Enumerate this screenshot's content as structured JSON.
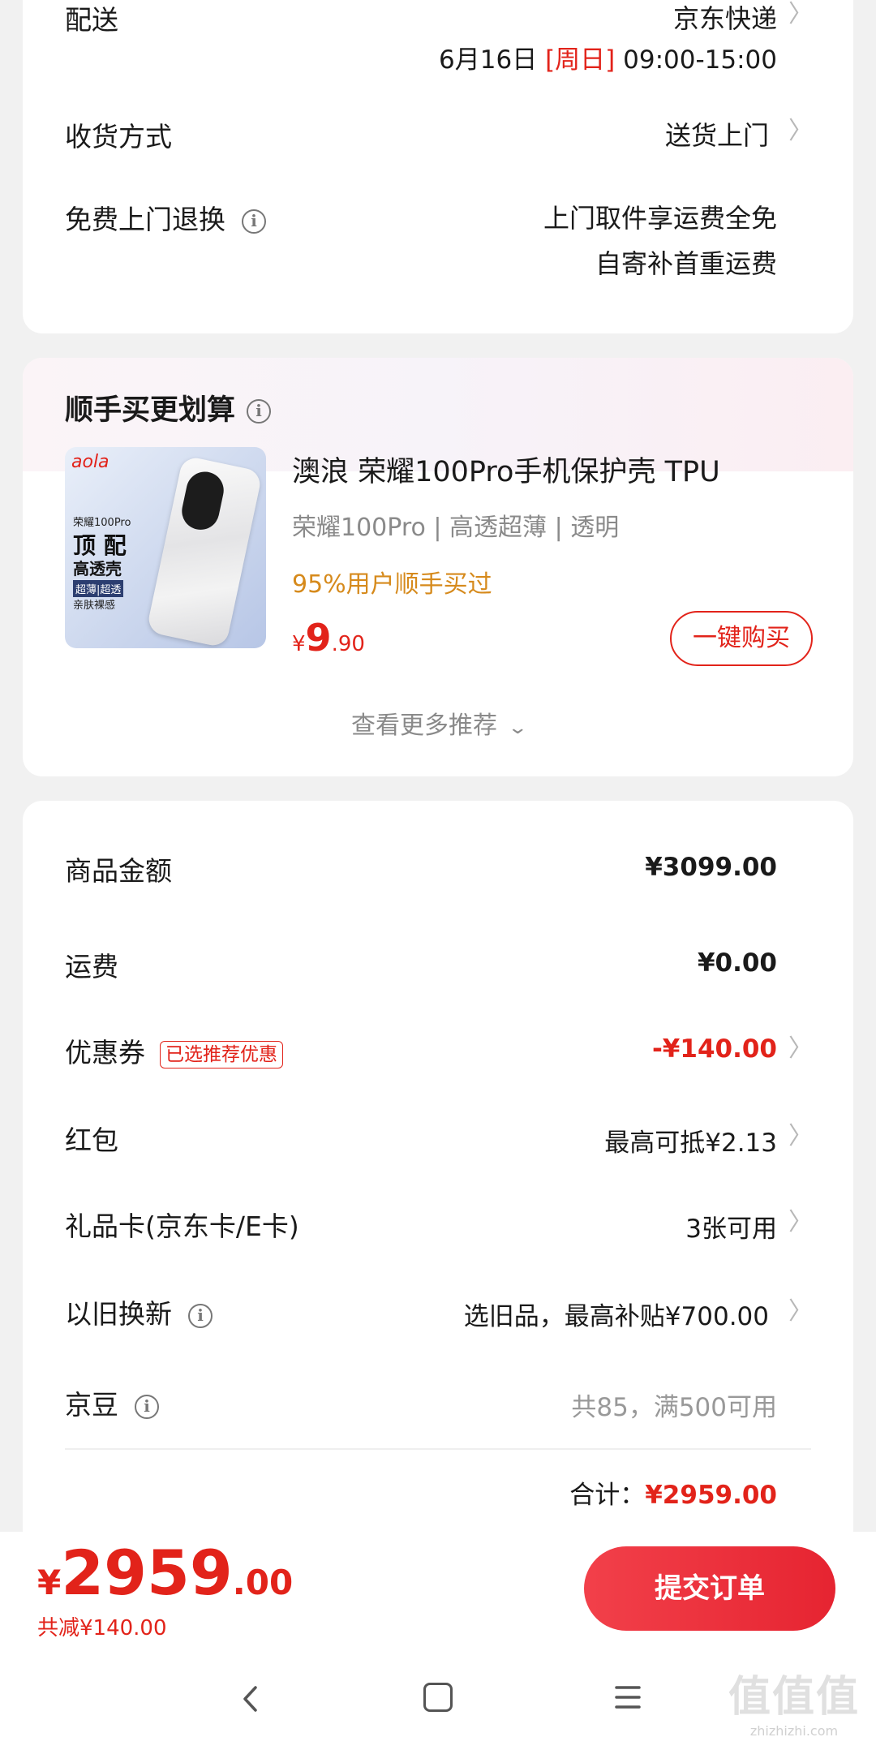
{
  "delivery": {
    "label": "配送",
    "carrier": "京东快递",
    "date": "6月16日",
    "weekday": "[周日]",
    "time": "09:00-15:00",
    "receive_label": "收货方式",
    "receive_value": "送货上门",
    "return_label": "免费上门退换",
    "return_line1": "上门取件享运费全免",
    "return_line2": "自寄补首重运费"
  },
  "recommend": {
    "title": "顺手买更划算",
    "product_title": "澳浪 荣耀100Pro手机保护壳 TPU",
    "product_specs": "荣耀100Pro | 高透超薄 | 透明",
    "product_tagline": "95%用户顺手买过",
    "price_symbol": "¥",
    "price_int": "9",
    "price_dec": ".90",
    "buy_label": "一键购买",
    "more_label": "查看更多推荐",
    "image": {
      "brand": "aola",
      "model": "荣耀100Pro",
      "headline": "顶 配",
      "sub": "高透壳",
      "tag1": "超薄|超透",
      "tag2": "亲肤裸感"
    }
  },
  "summary": {
    "items": [
      {
        "label": "商品金额",
        "value": "¥3099.00"
      },
      {
        "label": "运费",
        "value": "¥0.00"
      },
      {
        "label": "优惠券",
        "tag": "已选推荐优惠",
        "value": "-¥140.00"
      },
      {
        "label": "红包",
        "value": "最高可抵¥2.13"
      },
      {
        "label": "礼品卡(京东卡/E卡)",
        "value": "3张可用"
      },
      {
        "label": "以旧换新",
        "value": "选旧品，最高补贴¥700.00"
      },
      {
        "label": "京豆",
        "value": "共85，满500可用"
      }
    ],
    "total_label": "合计：",
    "total_value": "¥2959.00"
  },
  "footer": {
    "price_symbol": "¥",
    "price_int": "2959",
    "price_dec": ".00",
    "saved": "共减¥140.00",
    "submit_label": "提交订单"
  },
  "watermark": {
    "glyphs": "值值值",
    "url": "zhizhizhi.com"
  },
  "colors": {
    "accent": "#e2231a",
    "tagline": "#d68a1c",
    "background": "#f1f1f1"
  },
  "icons": [
    "info-icon",
    "chevron-right-icon",
    "chevron-down-icon",
    "nav-back-icon",
    "nav-home-icon",
    "nav-menu-icon"
  ]
}
